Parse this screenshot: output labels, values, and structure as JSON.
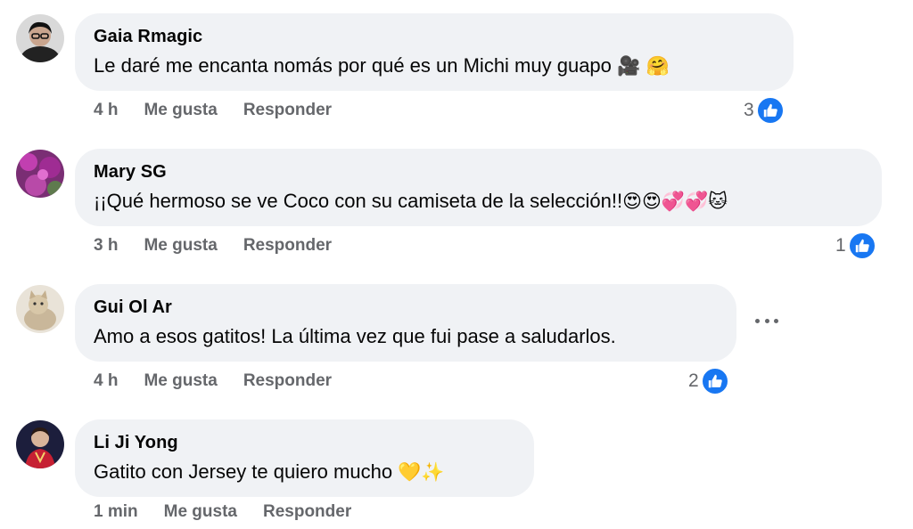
{
  "comments": [
    {
      "author": "Gaia Rmagic",
      "text": "Le daré me encanta nomás por qué es un Michi muy guapo",
      "emoji": "🎥 🤗",
      "time": "4 h",
      "like_label": "Me gusta",
      "reply_label": "Responder",
      "reaction_count": "3"
    },
    {
      "author": "Mary SG",
      "text": "¡¡Qué hermoso se ve Coco con su camiseta de la selección!!",
      "emoji": "😍😍💞💞🐱",
      "time": "3 h",
      "like_label": "Me gusta",
      "reply_label": "Responder",
      "reaction_count": "1"
    },
    {
      "author": "Gui Ol Ar",
      "text": "Amo a esos gatitos! La última vez que fui pase a saludarlos.",
      "emoji": "",
      "time": "4 h",
      "like_label": "Me gusta",
      "reply_label": "Responder",
      "reaction_count": "2"
    },
    {
      "author": "Li Ji Yong",
      "text": "Gatito con Jersey te quiero mucho",
      "emoji": "💛✨",
      "time": "1 min",
      "like_label": "Me gusta",
      "reply_label": "Responder",
      "reaction_count": ""
    }
  ],
  "icons": {
    "like": "like-thumb-icon",
    "more": "more-options-icon"
  },
  "colors": {
    "bubble": "#f0f2f5",
    "meta": "#65676b",
    "like_badge": "#1877f2"
  }
}
